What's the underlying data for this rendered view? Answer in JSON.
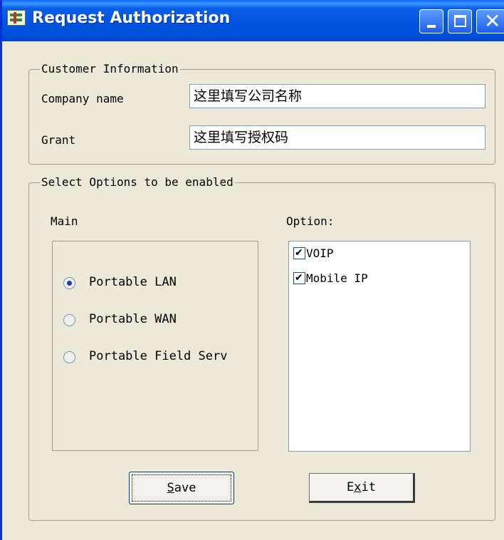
{
  "window": {
    "title": "Request Authorization"
  },
  "customer_info": {
    "legend": "Customer Information",
    "company_label": "Company name",
    "company_value": "这里填写公司名称",
    "grant_label": "Grant",
    "grant_value": "这里填写授权码"
  },
  "options_group": {
    "legend": "Select Options to be enabled",
    "main_label": "Main",
    "option_label": "Option:",
    "main_items": [
      {
        "label": "Portable LAN",
        "selected": true
      },
      {
        "label": "Portable WAN",
        "selected": false
      },
      {
        "label": "Portable Field Serv",
        "selected": false
      }
    ],
    "option_items": [
      {
        "label": "VOIP",
        "checked": true
      },
      {
        "label": "Mobile IP",
        "checked": true
      }
    ]
  },
  "buttons": {
    "save_pre": "",
    "save_mnemonic": "S",
    "save_post": "ave",
    "exit_pre": "E",
    "exit_mnemonic": "x",
    "exit_post": "it"
  },
  "icons": {
    "app": "app-icon",
    "minimize": "minimize-icon",
    "maximize": "maximize-icon",
    "close": "close-icon",
    "check": "✔",
    "close_glyph": "✕"
  },
  "colors": {
    "titlebar": "#0053e1",
    "face": "#ece9d8",
    "input_border": "#7f9db9"
  }
}
